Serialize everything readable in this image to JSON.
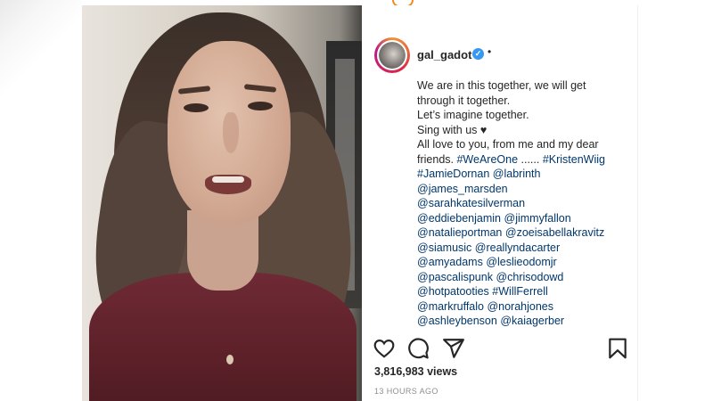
{
  "post": {
    "username": "gal_gadot",
    "verified_mark": "✓",
    "separator": "•",
    "caption_lines": [
      [
        {
          "t": "We are in this together, we will get",
          "tag": false
        }
      ],
      [
        {
          "t": "through it together.",
          "tag": false
        }
      ],
      [
        {
          "t": "Let’s imagine together.",
          "tag": false
        }
      ],
      [
        {
          "t": "Sing with us ♥",
          "tag": false
        }
      ],
      [
        {
          "t": "All love to you, from me and my dear",
          "tag": false
        }
      ],
      [
        {
          "t": "friends. ",
          "tag": false
        },
        {
          "t": "#WeAreOne",
          "tag": true
        },
        {
          "t": " ...... ",
          "tag": false
        },
        {
          "t": "#KristenWiig",
          "tag": true
        }
      ],
      [
        {
          "t": "#JamieDornan",
          "tag": true
        },
        {
          "t": " ",
          "tag": false
        },
        {
          "t": "@labrinth",
          "tag": true
        }
      ],
      [
        {
          "t": "@james_marsden",
          "tag": true
        }
      ],
      [
        {
          "t": "@sarahkatesilverman",
          "tag": true
        }
      ],
      [
        {
          "t": "@eddiebenjamin",
          "tag": true
        },
        {
          "t": " ",
          "tag": false
        },
        {
          "t": "@jimmyfallon",
          "tag": true
        }
      ],
      [
        {
          "t": "@natalieportman",
          "tag": true
        },
        {
          "t": " ",
          "tag": false
        },
        {
          "t": "@zoeisabellakravitz",
          "tag": true
        }
      ],
      [
        {
          "t": "@siamusic",
          "tag": true
        },
        {
          "t": " ",
          "tag": false
        },
        {
          "t": "@reallyndacarter",
          "tag": true
        }
      ],
      [
        {
          "t": "@amyadams",
          "tag": true
        },
        {
          "t": " ",
          "tag": false
        },
        {
          "t": "@leslieodomjr",
          "tag": true
        }
      ],
      [
        {
          "t": "@pascalispunk",
          "tag": true
        },
        {
          "t": " ",
          "tag": false
        },
        {
          "t": "@chrisodowd",
          "tag": true
        }
      ],
      [
        {
          "t": "@hotpatooties",
          "tag": true
        },
        {
          "t": " ",
          "tag": false
        },
        {
          "t": "#WillFerrell",
          "tag": true
        }
      ],
      [
        {
          "t": "@markruffalo",
          "tag": true
        },
        {
          "t": " ",
          "tag": false
        },
        {
          "t": "@norahjones",
          "tag": true
        }
      ],
      [
        {
          "t": "@ashleybenson",
          "tag": true
        },
        {
          "t": " ",
          "tag": false
        },
        {
          "t": "@kaiagerber",
          "tag": true
        }
      ]
    ],
    "views_count": "3,816,983",
    "views_label": " views",
    "timestamp": "13 HOURS AGO"
  },
  "icons": {
    "like": "heart-outline-icon",
    "comment": "speech-bubble-icon",
    "share": "paper-plane-icon",
    "save": "bookmark-icon"
  },
  "colors": {
    "text": "#262626",
    "link": "#00376b",
    "verified": "#3897f0",
    "muted": "#8e8e8e"
  }
}
